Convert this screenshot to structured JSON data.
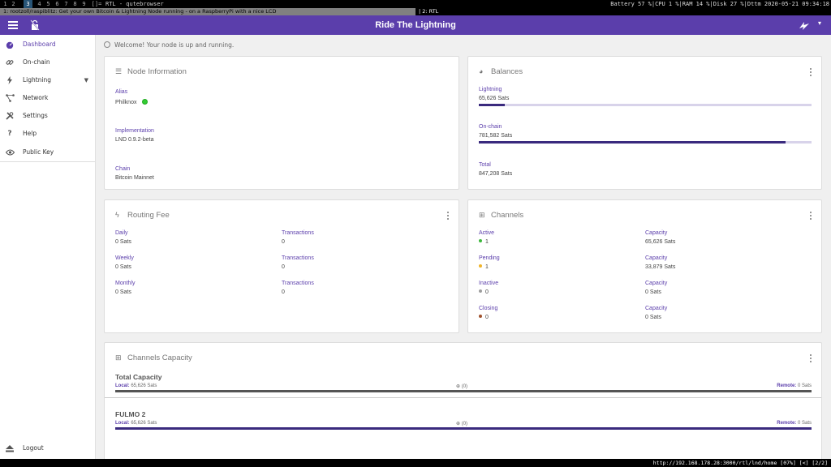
{
  "i3": {
    "workspaces": [
      "1",
      "2",
      "3",
      "4",
      "5",
      "6",
      "7",
      "8",
      "9",
      "[]="
    ],
    "window_title": "RTL - qutebrowser",
    "status": "Battery 57 %|CPU 1 %|RAM 14 %|Disk 27 %|Dttm 2020-05-21 09:34:18"
  },
  "tabs": {
    "tab1": "1: rootzoll/raspiblitz: Get your own Bitcoin & Lightning Node running - on a RaspberryPi with a nice LCD",
    "tab2": "2: RTL"
  },
  "app": {
    "title": "Ride The Lightning"
  },
  "sidebar": {
    "items": [
      {
        "label": "Dashboard",
        "icon": "speedometer-icon"
      },
      {
        "label": "On-chain",
        "icon": "link-icon"
      },
      {
        "label": "Lightning",
        "icon": "bolt-icon"
      },
      {
        "label": "Network",
        "icon": "network-icon"
      },
      {
        "label": "Settings",
        "icon": "tools-icon"
      },
      {
        "label": "Help",
        "icon": "question-icon"
      },
      {
        "label": "Public Key",
        "icon": "eye-icon"
      }
    ],
    "logout": "Logout"
  },
  "welcome": "Welcome! Your node is up and running.",
  "node_info": {
    "title": "Node Information",
    "alias_label": "Alias",
    "alias": "Philknox",
    "impl_label": "Implementation",
    "impl": "LND 0.9.2-beta",
    "chain_label": "Chain",
    "chain": "Bitcoin Mainnet"
  },
  "balances": {
    "title": "Balances",
    "lightning_label": "Lightning",
    "lightning": "65,626 Sats",
    "lightning_fraction": 0.077,
    "onchain_label": "On-chain",
    "onchain": "781,582 Sats",
    "onchain_fraction": 0.923,
    "total_label": "Total",
    "total": "847,208 Sats"
  },
  "routing_fee": {
    "title": "Routing Fee",
    "rows": [
      {
        "label": "Daily",
        "value": "0 Sats",
        "tx_label": "Transactions",
        "tx": "0"
      },
      {
        "label": "Weekly",
        "value": "0 Sats",
        "tx_label": "Transactions",
        "tx": "0"
      },
      {
        "label": "Monthly",
        "value": "0 Sats",
        "tx_label": "Transactions",
        "tx": "0"
      }
    ]
  },
  "channels": {
    "title": "Channels",
    "rows": [
      {
        "label": "Active",
        "count": "1",
        "color": "#3cb83c",
        "cap_label": "Capacity",
        "cap": "65,626 Sats"
      },
      {
        "label": "Pending",
        "count": "1",
        "color": "#f0b429",
        "cap_label": "Capacity",
        "cap": "33,879 Sats"
      },
      {
        "label": "Inactive",
        "count": "0",
        "color": "#9e9e9e",
        "cap_label": "Capacity",
        "cap": "0 Sats"
      },
      {
        "label": "Closing",
        "count": "0",
        "color": "#a0522d",
        "cap_label": "Capacity",
        "cap": "0 Sats"
      }
    ]
  },
  "capacity": {
    "title": "Channels Capacity",
    "total_title": "Total Capacity",
    "local_label": "Local:",
    "local": "65,626 Sats",
    "mid": "(0)",
    "remote_label": "Remote:",
    "remote": "0 Sats",
    "peer_title": "FULMO 2",
    "peer_local": "65,626 Sats",
    "peer_remote": "0 Sats",
    "peer_mid": "(0)"
  },
  "statusbar": {
    "url": "http://192.168.178.28:3000/rtl/lnd/home [07%] [<] [2/2]"
  },
  "colors": {
    "primary": "#5b3eab",
    "bar_dark": "#3a2a7e"
  }
}
